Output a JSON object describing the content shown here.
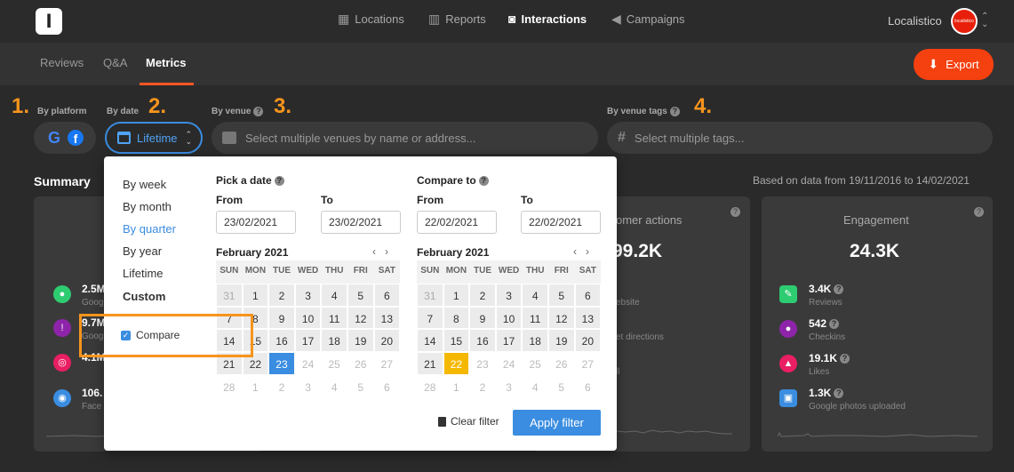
{
  "header": {
    "logo_text": "l",
    "nav": [
      {
        "label": "Locations",
        "icon": "building-icon"
      },
      {
        "label": "Reports",
        "icon": "bar-chart-icon"
      },
      {
        "label": "Interactions",
        "icon": "chat-user-icon",
        "active": true
      },
      {
        "label": "Campaigns",
        "icon": "megaphone-icon"
      }
    ],
    "user_name": "Localistico",
    "avatar_text": "localistico"
  },
  "subnav": {
    "tabs": [
      "Reviews",
      "Q&A",
      "Metrics"
    ],
    "active_tab": "Metrics",
    "export_label": "Export"
  },
  "filters": {
    "steps": [
      "1.",
      "2.",
      "3.",
      "4."
    ],
    "by_platform_label": "By platform",
    "by_date_label": "By date",
    "date_value": "Lifetime",
    "by_venue_label": "By venue",
    "venue_placeholder": "Select multiple venues by name or address...",
    "by_tags_label": "By venue tags",
    "tags_placeholder": "Select multiple tags..."
  },
  "summary": {
    "title": "Summary",
    "based_on": "Based on data from 19/11/2016 to 14/02/2021",
    "left_metrics": [
      {
        "value": "2.5M",
        "sub": "Goog"
      },
      {
        "value": "9.7M",
        "sub": "Goog"
      },
      {
        "value": "4.1M",
        "sub": ""
      },
      {
        "value": "106.",
        "sub": "Face"
      }
    ],
    "customer_actions": {
      "title": "omer actions",
      "value": "99.2K",
      "rows": [
        "ebsite",
        "et directions",
        "ll"
      ]
    },
    "engagement": {
      "title": "Engagement",
      "value": "24.3K",
      "metrics": [
        {
          "value": "3.4K",
          "sub": "Reviews",
          "color": "#2ecc71"
        },
        {
          "value": "542",
          "sub": "Checkins",
          "color": "#8e24aa"
        },
        {
          "value": "19.1K",
          "sub": "Likes",
          "color": "#e91e63"
        },
        {
          "value": "1.3K",
          "sub": "Google photos uploaded",
          "color": "#3a8de0"
        }
      ]
    }
  },
  "date_popup": {
    "periods": [
      "By week",
      "By month",
      "By quarter",
      "By year",
      "Lifetime",
      "Custom"
    ],
    "active_period": "By quarter",
    "compare_label": "Compare",
    "pick_title": "Pick a date",
    "compare_title": "Compare to",
    "from_label": "From",
    "to_label": "To",
    "pick_from": "23/02/2021",
    "pick_to": "23/02/2021",
    "compare_from": "22/02/2021",
    "compare_to": "22/02/2021",
    "month_label": "February 2021",
    "weekdays": [
      "SUN",
      "MON",
      "TUE",
      "WED",
      "THU",
      "FRI",
      "SAT"
    ],
    "clear_label": "Clear filter",
    "apply_label": "Apply filter"
  },
  "colors": {
    "accent_orange": "#f5400f",
    "annotation_orange": "#f7941d",
    "selection_blue": "#3a8de0",
    "selection_yellow": "#f5b800"
  }
}
